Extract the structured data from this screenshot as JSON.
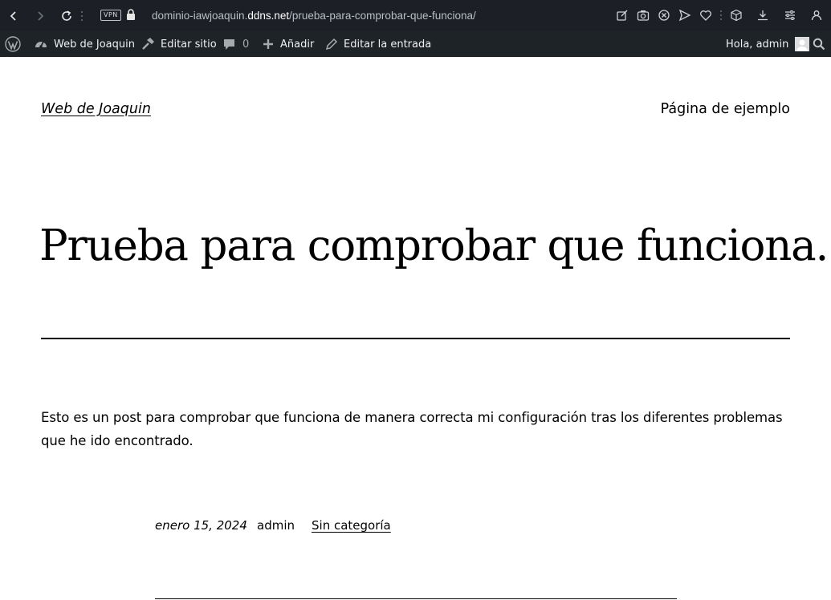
{
  "browser": {
    "vpn_label": "VPN",
    "url_host_prefix": "dominio-iawjoaquin.",
    "url_host_main": "ddns.net",
    "url_path": "/prueba-para-comprobar-que-funciona/"
  },
  "adminbar": {
    "site_name": "Web de Joaquin",
    "edit_site": "Editar sitio",
    "comments_count": "0",
    "add_new": "Añadir",
    "edit_post": "Editar la entrada",
    "greeting": "Hola, admin"
  },
  "site": {
    "title": "Web de Joaquin",
    "nav_link": "Página de ejemplo"
  },
  "post": {
    "title": "Prueba para comprobar que funciona.",
    "body": "Esto es un post para comprobar que funciona de manera correcta mi configuración tras los diferentes problemas que he ido encontrado.",
    "date": "enero 15, 2024",
    "author": "admin",
    "category": "Sin categoría"
  }
}
